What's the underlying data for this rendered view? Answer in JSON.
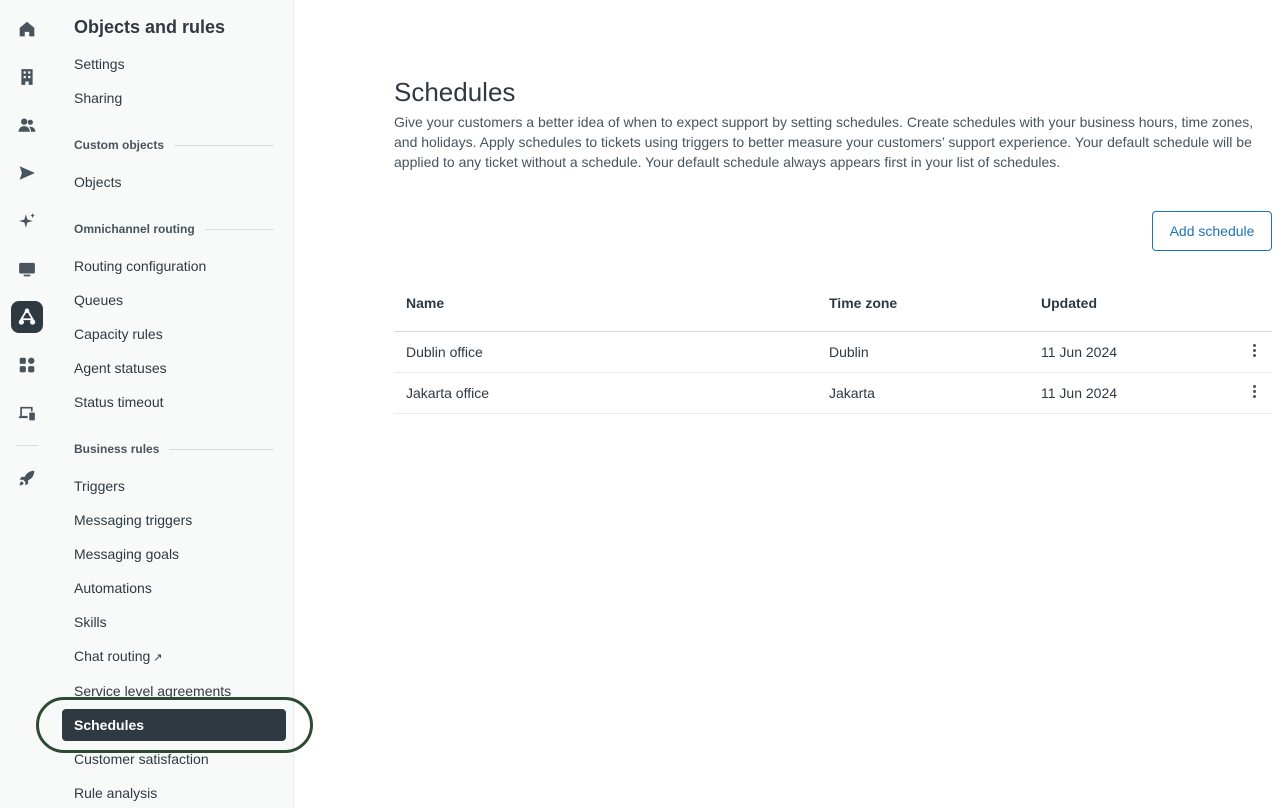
{
  "rail": {
    "icons": [
      "home-icon",
      "building-icon",
      "people-icon",
      "send-icon",
      "sparkle-icon",
      "monitor-icon",
      "objects-rules-icon",
      "apps-icon",
      "device-icon",
      "rocket-icon"
    ]
  },
  "subnav": {
    "title": "Objects and rules",
    "items": {
      "settings": "Settings",
      "sharing": "Sharing",
      "objects": "Objects",
      "routing_configuration": "Routing configuration",
      "queues": "Queues",
      "capacity_rules": "Capacity rules",
      "agent_statuses": "Agent statuses",
      "status_timeout": "Status timeout",
      "triggers": "Triggers",
      "messaging_triggers": "Messaging triggers",
      "messaging_goals": "Messaging goals",
      "automations": "Automations",
      "skills": "Skills",
      "chat_routing": "Chat routing",
      "service_level_agreements": "Service level agreements",
      "schedules": "Schedules",
      "customer_satisfaction": "Customer satisfaction",
      "rule_analysis": "Rule analysis"
    },
    "sections": {
      "custom_objects": "Custom objects",
      "omnichannel_routing": "Omnichannel routing",
      "business_rules": "Business rules"
    }
  },
  "main": {
    "title": "Schedules",
    "description": "Give your customers a better idea of when to expect support by setting schedules. Create schedules with your business hours, time zones, and holidays. Apply schedules to tickets using triggers to better measure your customers’ support experience. Your default schedule will be applied to any ticket without a schedule. Your default schedule always appears first in your list of schedules.",
    "add_button": "Add schedule",
    "table": {
      "headers": {
        "name": "Name",
        "time_zone": "Time zone",
        "updated": "Updated"
      },
      "rows": [
        {
          "name": "Dublin office",
          "time_zone": "Dublin",
          "updated": "11 Jun 2024"
        },
        {
          "name": "Jakarta office",
          "time_zone": "Jakarta",
          "updated": "11 Jun 2024"
        }
      ]
    }
  },
  "colors": {
    "accent": "#1f73b7",
    "nav_selected": "#2f3941",
    "highlight": "#2d4a33"
  }
}
